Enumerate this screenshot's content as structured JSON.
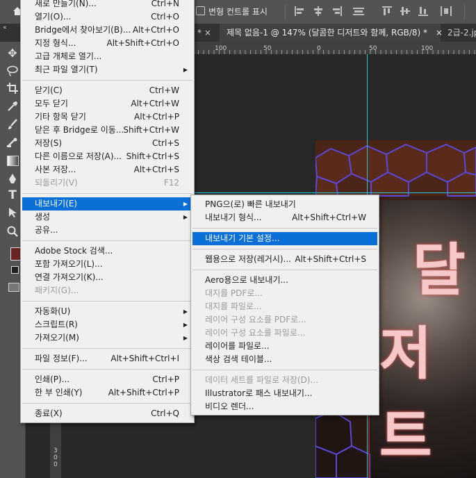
{
  "options_bar": {
    "transform_controls_label": "변형 컨트롤 표시"
  },
  "tabs": [
    {
      "label": "* ×",
      "active": false
    },
    {
      "label": "제목 없음-1 @ 147% (달콤한 디저트와 함께, RGB/8) *",
      "close": "×",
      "active": true
    },
    {
      "label": "2급-2.jp",
      "active": false
    }
  ],
  "ruler_h": [
    "100",
    "50",
    "0",
    "50",
    "100"
  ],
  "ruler_v": [
    "3",
    "0",
    "0"
  ],
  "canvas_text": {
    "line1": "달",
    "line2": "저트"
  },
  "file_menu": [
    {
      "label": "새로 만들기(N)...",
      "shortcut": "Ctrl+N"
    },
    {
      "label": "열기(O)...",
      "shortcut": "Ctrl+O"
    },
    {
      "label": "Bridge에서 찾아보기(B)...",
      "shortcut": "Alt+Ctrl+O"
    },
    {
      "label": "지정 형식...",
      "shortcut": "Alt+Shift+Ctrl+O"
    },
    {
      "label": "고급 개체로 열기...",
      "shortcut": ""
    },
    {
      "label": "최근 파일 열기(T)",
      "shortcut": "",
      "submenu": true
    },
    {
      "sep": true
    },
    {
      "label": "닫기(C)",
      "shortcut": "Ctrl+W"
    },
    {
      "label": "모두 닫기",
      "shortcut": "Alt+Ctrl+W"
    },
    {
      "label": "기타 항목 닫기",
      "shortcut": "Alt+Ctrl+P"
    },
    {
      "label": "닫은 후 Bridge로 이동...",
      "shortcut": "Shift+Ctrl+W"
    },
    {
      "label": "저장(S)",
      "shortcut": "Ctrl+S"
    },
    {
      "label": "다른 이름으로 저장(A)...",
      "shortcut": "Shift+Ctrl+S"
    },
    {
      "label": "사본 저장...",
      "shortcut": "Alt+Ctrl+S"
    },
    {
      "label": "되돌리기(V)",
      "shortcut": "F12",
      "disabled": true
    },
    {
      "sep": true
    },
    {
      "label": "내보내기(E)",
      "shortcut": "",
      "submenu": true,
      "highlighted": true
    },
    {
      "label": "생성",
      "shortcut": "",
      "submenu": true
    },
    {
      "label": "공유...",
      "shortcut": ""
    },
    {
      "sep": true
    },
    {
      "label": "Adobe Stock 검색...",
      "shortcut": ""
    },
    {
      "label": "포함 가져오기(L)...",
      "shortcut": ""
    },
    {
      "label": "연결 가져오기(K)...",
      "shortcut": ""
    },
    {
      "label": "패키지(G)...",
      "shortcut": "",
      "disabled": true
    },
    {
      "sep": true
    },
    {
      "label": "자동화(U)",
      "shortcut": "",
      "submenu": true
    },
    {
      "label": "스크립트(R)",
      "shortcut": "",
      "submenu": true
    },
    {
      "label": "가져오기(M)",
      "shortcut": "",
      "submenu": true
    },
    {
      "sep": true
    },
    {
      "label": "파일 정보(F)...",
      "shortcut": "Alt+Shift+Ctrl+I"
    },
    {
      "sep": true
    },
    {
      "label": "인쇄(P)...",
      "shortcut": "Ctrl+P"
    },
    {
      "label": "한 부 인쇄(Y)",
      "shortcut": "Alt+Shift+Ctrl+P"
    },
    {
      "sep": true
    },
    {
      "label": "종료(X)",
      "shortcut": "Ctrl+Q"
    }
  ],
  "export_submenu": [
    {
      "label": "PNG으(로) 빠른 내보내기",
      "shortcut": ""
    },
    {
      "label": "내보내기 형식...",
      "shortcut": "Alt+Shift+Ctrl+W"
    },
    {
      "sep": true
    },
    {
      "label": "내보내기 기본 설정...",
      "shortcut": "",
      "highlighted": true
    },
    {
      "sep": true
    },
    {
      "label": "웹용으로 저장(레거시)...",
      "shortcut": "Alt+Shift+Ctrl+S"
    },
    {
      "sep": true
    },
    {
      "label": "Aero용으로 내보내기...",
      "shortcut": ""
    },
    {
      "label": "대지를 PDF로...",
      "shortcut": "",
      "disabled": true
    },
    {
      "label": "대지를 파일로...",
      "shortcut": "",
      "disabled": true
    },
    {
      "label": "레이어 구성 요소를 PDF로...",
      "shortcut": "",
      "disabled": true
    },
    {
      "label": "레이어 구성 요소를 파일로...",
      "shortcut": "",
      "disabled": true
    },
    {
      "label": "레이어를 파일로...",
      "shortcut": ""
    },
    {
      "label": "색상 검색 테이블...",
      "shortcut": ""
    },
    {
      "sep": true
    },
    {
      "label": "데이터 세트를 파일로 저장(D)...",
      "shortcut": "",
      "disabled": true
    },
    {
      "label": "Illustrator로 패스 내보내기...",
      "shortcut": ""
    },
    {
      "label": "비디오 렌더...",
      "shortcut": ""
    }
  ],
  "colors": {
    "highlight": "#0a6fd6",
    "guide": "#1fc9d8",
    "foreground_swatch": "#6b2424"
  }
}
